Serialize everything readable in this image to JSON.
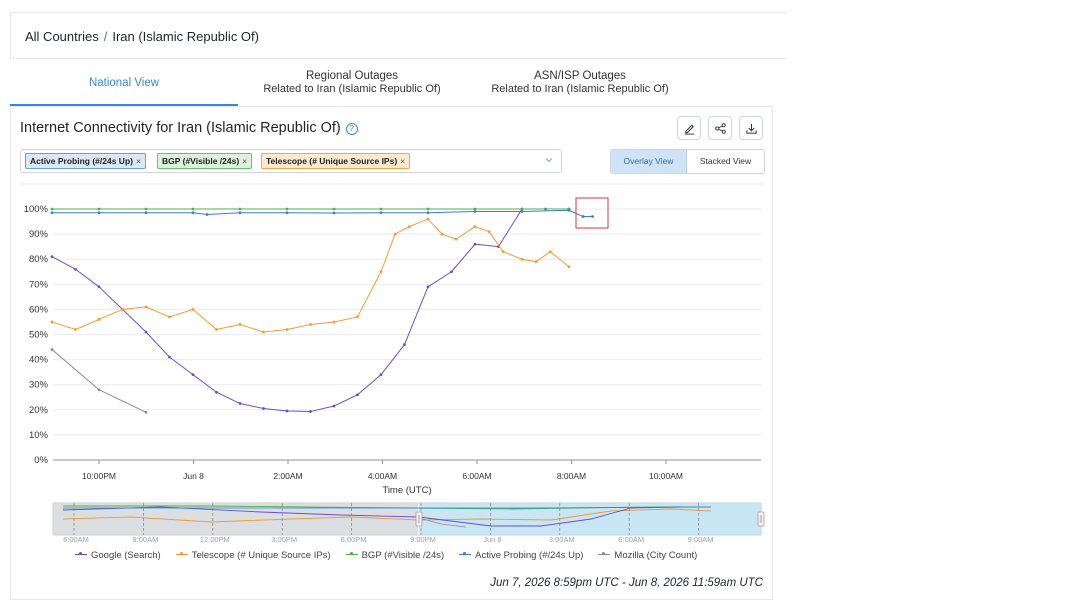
{
  "breadcrumb": {
    "root": "All Countries",
    "separator": "/",
    "current": "Iran (Islamic Republic Of)"
  },
  "tabs": [
    {
      "line1": "National View",
      "line2": ""
    },
    {
      "line1": "Regional Outages",
      "line2": "Related to Iran (Islamic Republic Of)"
    },
    {
      "line1": "ASN/ISP Outages",
      "line2": "Related to Iran (Islamic Republic Of)"
    }
  ],
  "panel": {
    "title": "Internet Connectivity for Iran (Islamic Republic Of)",
    "help_glyph": "?",
    "tags": [
      {
        "label": "Active Probing (#/24s Up)",
        "remove": "×"
      },
      {
        "label": "BGP (#Visible /24s)",
        "remove": "×"
      },
      {
        "label": "Telescope (# Unique Source IPs)",
        "remove": "×"
      }
    ],
    "overlay_label": "Overlay View",
    "stacked_label": "Stacked View",
    "date_range": "Jun 7, 2026 8:59pm UTC - Jun 8, 2026 11:59am UTC"
  },
  "icons": {
    "edit": "pencil-icon",
    "share": "share-icon",
    "download": "download-icon"
  },
  "colors": {
    "accent": "#3a86d6",
    "google": "#6b4fc8",
    "telescope": "#f29b38",
    "bgp": "#4caf50",
    "active_probing": "#3b7dd8",
    "mozilla": "#8a87a8",
    "highlight": "#d9363e"
  },
  "chart_data": {
    "type": "line",
    "xlabel": "Time (UTC)",
    "ylabel": "",
    "x_ticks": [
      "10:00PM",
      "Jun 8",
      "2:00AM",
      "4:00AM",
      "6:00AM",
      "8:00AM",
      "10:00AM"
    ],
    "y_ticks": [
      "0%",
      "10%",
      "20%",
      "30%",
      "40%",
      "50%",
      "60%",
      "70%",
      "80%",
      "90%",
      "100%"
    ],
    "ylim": [
      0,
      100
    ],
    "x_hours": [
      0,
      15
    ],
    "navigator_ticks": [
      "6:00AM",
      "9:00AM",
      "12:00PM",
      "3:00PM",
      "6:00PM",
      "9:00PM",
      "Jun 8",
      "3:00AM",
      "6:00AM",
      "9:00AM"
    ],
    "series": [
      {
        "name": "Google (Search)",
        "x": [
          0,
          0.5,
          1,
          1.5,
          2,
          2.5,
          3,
          3.5,
          4,
          4.5,
          5,
          5.5,
          6,
          6.5,
          7,
          7.5,
          8,
          8.5,
          9,
          9.5,
          10,
          10.5,
          11
        ],
        "values": [
          81,
          76,
          69,
          60,
          51,
          41,
          34,
          27,
          22.5,
          20.5,
          19.5,
          19.3,
          21.5,
          26,
          34,
          46,
          69,
          75,
          86,
          85,
          100,
          100,
          100
        ]
      },
      {
        "name": "Telescope (# Unique Source IPs)",
        "x": [
          0,
          0.5,
          1,
          1.5,
          2,
          2.5,
          3,
          3.5,
          4,
          4.5,
          5,
          5.5,
          6,
          6.5,
          7,
          7.3,
          7.6,
          8,
          8.3,
          8.6,
          9,
          9.3,
          9.6,
          10,
          10.3,
          10.6,
          11
        ],
        "values": [
          55,
          52,
          56,
          60,
          61,
          57,
          60,
          52,
          54,
          51,
          52,
          54,
          55,
          57,
          75,
          90,
          93,
          96,
          90,
          88,
          93,
          91,
          83,
          80,
          79,
          83,
          77
        ]
      },
      {
        "name": "BGP (#Visible /24s)",
        "x": [
          0,
          1,
          2,
          3,
          4,
          5,
          6,
          7,
          8,
          9,
          10,
          11
        ],
        "values": [
          100,
          100,
          100,
          100,
          100,
          100,
          100,
          100,
          100,
          100,
          100,
          100
        ]
      },
      {
        "name": "Active Probing (#/24s Up)",
        "x": [
          0,
          1,
          2,
          3,
          3.3,
          4,
          5,
          6,
          7,
          8,
          9,
          10,
          11,
          11.3,
          11.5
        ],
        "values": [
          98.5,
          98.5,
          98.5,
          98.5,
          97.8,
          98.5,
          98.5,
          98.4,
          98.5,
          98.5,
          99,
          99,
          99.5,
          97,
          97
        ]
      },
      {
        "name": "Mozilla (City Count)",
        "x": [
          0,
          1,
          2
        ],
        "values": [
          44,
          28,
          19
        ]
      }
    ],
    "legend_position": "bottom",
    "grid": true
  }
}
